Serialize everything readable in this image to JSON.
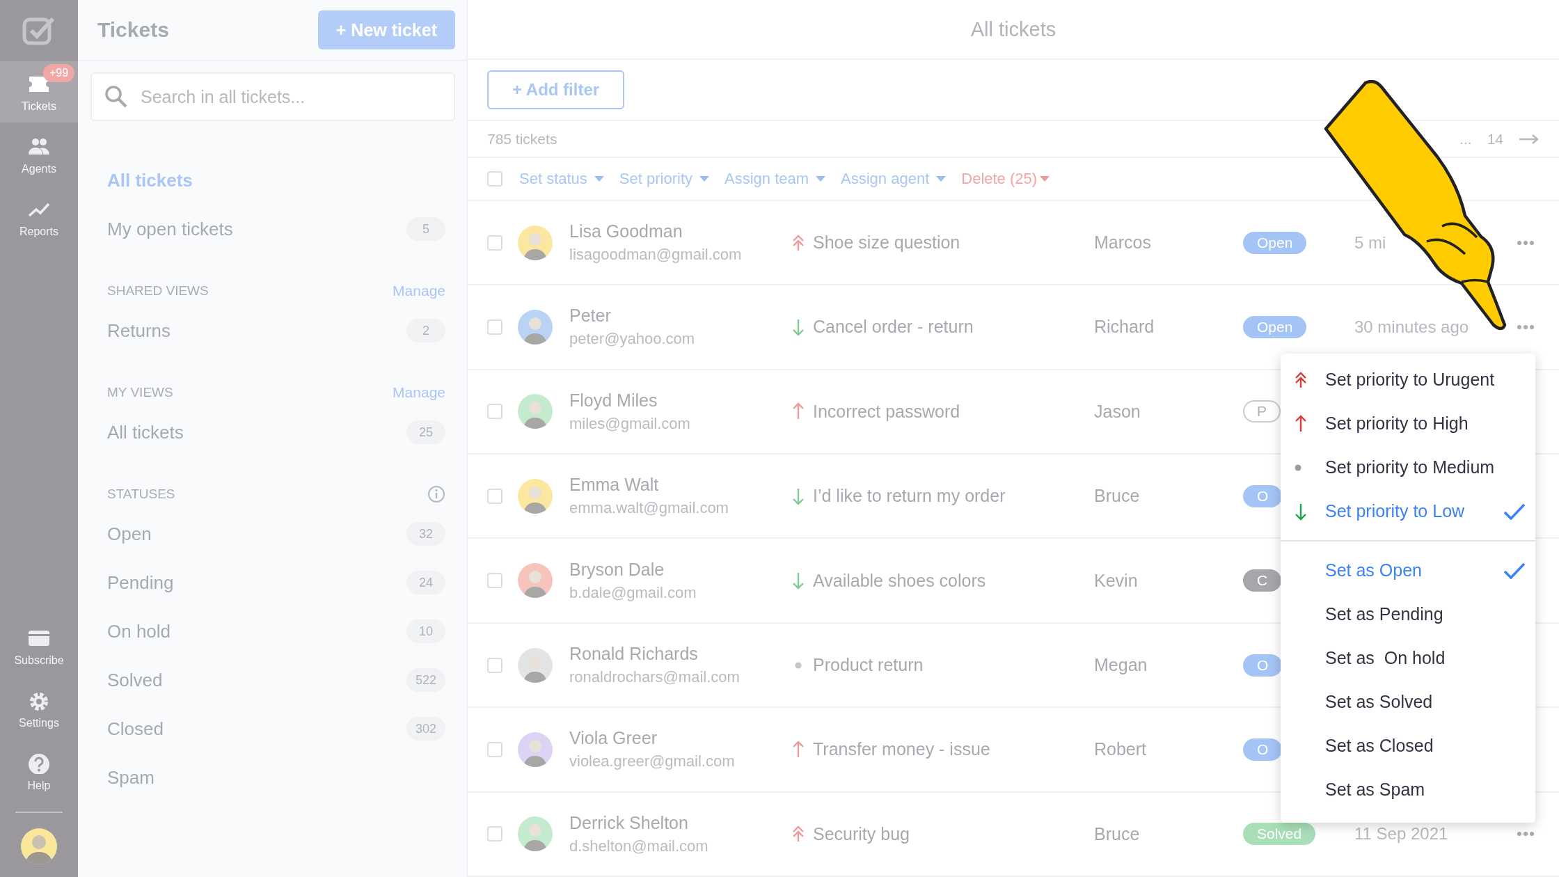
{
  "sidebar": {
    "top_items": [
      {
        "kind": "tickets",
        "label": "Tickets",
        "badge": "+99",
        "selected": true
      },
      {
        "kind": "agents",
        "label": "Agents",
        "selected": false
      },
      {
        "kind": "reports",
        "label": "Reports",
        "selected": false
      }
    ],
    "bottom_items": [
      {
        "kind": "subscribe",
        "label": "Subscribe",
        "selected": false
      },
      {
        "kind": "settings",
        "label": "Settings",
        "selected": false
      },
      {
        "kind": "help",
        "label": "Help",
        "selected": false
      }
    ]
  },
  "panel": {
    "title": "Tickets",
    "new_button": "+ New ticket",
    "search": {
      "placeholder": "Search in all tickets..."
    },
    "sections": [
      {
        "items": [
          {
            "label": "All tickets",
            "selected": true
          },
          {
            "label": "My open tickets",
            "count": "5",
            "selected": false
          }
        ]
      },
      {
        "heading": "SHARED VIEWS",
        "action": "Manage",
        "items": [
          {
            "label": "Returns",
            "count": "2",
            "selected": false
          }
        ]
      },
      {
        "heading": "MY VIEWS",
        "action": "Manage",
        "items": [
          {
            "label": "All tickets",
            "count": "25",
            "selected": false
          }
        ]
      },
      {
        "heading": "STATUSES",
        "info": true,
        "items": [
          {
            "label": "Open",
            "count": "32",
            "selected": false
          },
          {
            "label": "Pending",
            "count": "24",
            "selected": false
          },
          {
            "label": "On hold",
            "count": "10",
            "selected": false
          },
          {
            "label": "Solved",
            "count": "522",
            "selected": false
          },
          {
            "label": "Closed",
            "count": "302",
            "selected": false
          },
          {
            "label": "Spam",
            "selected": false
          }
        ]
      }
    ]
  },
  "main": {
    "title": "All tickets",
    "add_filter": "+ Add filter",
    "ticket_count": "785 tickets",
    "pagination": {
      "ellipsis": "...",
      "last": "14"
    },
    "select_all": {
      "checked": false
    },
    "bulk_actions": [
      {
        "label": "Set status",
        "kind": "normal"
      },
      {
        "label": "Set priority",
        "kind": "normal"
      },
      {
        "label": "Assign team",
        "kind": "normal"
      },
      {
        "label": "Assign agent",
        "kind": "normal"
      },
      {
        "label": "Delete (25)",
        "kind": "danger"
      }
    ],
    "rows": [
      {
        "checked": false,
        "name": "Lisa Goodman",
        "email": "lisagoodman@gmail.com",
        "color": "#fbe7a0",
        "kind": "urgent",
        "subject": "Shoe size question",
        "agent": "Marcos",
        "status": {
          "label": "Open",
          "kind": "open"
        },
        "time": "5 mi"
      },
      {
        "checked": false,
        "name": "Peter",
        "email": "peter@yahoo.com",
        "color": "#b9d3f5",
        "kind": "low",
        "subject": "Cancel order - return",
        "agent": "Richard",
        "status": {
          "label": "Open",
          "kind": "open"
        },
        "time": "30 minutes ago"
      },
      {
        "checked": false,
        "name": "Floyd Miles",
        "email": "miles@gmail.com",
        "color": "#c4ebcd",
        "kind": "high",
        "subject": "Incorrect password",
        "agent": "Jason",
        "status": {
          "label": "P",
          "kind": "pending"
        }
      },
      {
        "checked": false,
        "name": "Emma Walt",
        "email": "emma.walt@gmail.com",
        "color": "#fbe7a0",
        "kind": "low",
        "subject": "I’d like to return my order",
        "agent": "Bruce",
        "status": {
          "label": "O",
          "kind": "open"
        }
      },
      {
        "checked": false,
        "name": "Bryson Dale",
        "email": "b.dale@gmail.com",
        "color": "#f7c4bd",
        "kind": "low",
        "subject": "Available shoes colors",
        "agent": "Kevin",
        "status": {
          "label": "C",
          "kind": "closed"
        }
      },
      {
        "checked": false,
        "name": "Ronald Richards",
        "email": "ronaldrochars@mail.com",
        "color": "#e3e4e6",
        "kind": "medium",
        "subject": "Product return",
        "agent": "Megan",
        "status": {
          "label": "O",
          "kind": "open"
        }
      },
      {
        "checked": false,
        "name": "Viola Greer",
        "email": "violea.greer@gmail.com",
        "color": "#dcd3f5",
        "kind": "high",
        "subject": "Transfer money - issue",
        "agent": "Robert",
        "status": {
          "label": "O",
          "kind": "open"
        }
      },
      {
        "checked": false,
        "name": "Derrick Shelton",
        "email": "d.shelton@mail.com",
        "color": "#c4ebcd",
        "kind": "urgent",
        "subject": "Security bug",
        "agent": "Bruce",
        "status": {
          "label": "Solved",
          "kind": "solved"
        },
        "time": "11 Sep 2021"
      }
    ],
    "menu": {
      "groups": [
        [
          {
            "kind": "urgent",
            "label": "Set priority to Urugent",
            "selected": false
          },
          {
            "kind": "high",
            "label": "Set priority to High",
            "selected": false
          },
          {
            "kind": "medium",
            "label": "Set priority to Medium",
            "selected": false
          },
          {
            "kind": "low",
            "label": "Set priority to Low",
            "selected": true
          }
        ],
        [
          {
            "label": "Set as Open",
            "selected": true
          },
          {
            "label": "Set as Pending",
            "selected": false
          },
          {
            "label": "Set as  On hold",
            "selected": false
          },
          {
            "label": "Set as Solved",
            "selected": false
          },
          {
            "label": "Set as Closed",
            "selected": false
          },
          {
            "label": "Set as Spam",
            "selected": false
          }
        ]
      ]
    }
  }
}
